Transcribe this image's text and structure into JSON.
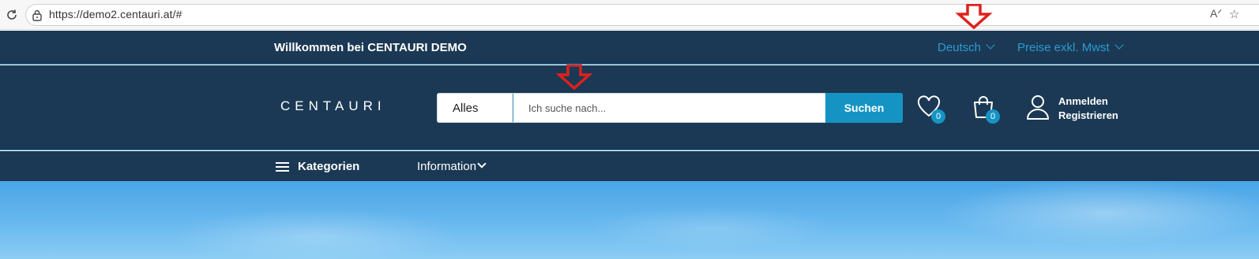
{
  "browser": {
    "url": "https://demo2.centauri.at/#"
  },
  "topbar": {
    "welcome": "Willkommen bei CENTAURI DEMO",
    "language": "Deutsch",
    "price_mode": "Preise exkl. Mwst"
  },
  "header": {
    "logo": "CENTAURI",
    "search": {
      "category": "Alles",
      "placeholder": "Ich suche nach...",
      "button": "Suchen"
    },
    "wishlist_count": "0",
    "cart_count": "0",
    "login": "Anmelden",
    "register": "Registrieren"
  },
  "nav": {
    "categories": "Kategorien",
    "information": "Information"
  },
  "colors": {
    "header_bg": "#1b3954",
    "accent": "#1594c4",
    "link": "#2b9bd1",
    "annotation": "#e0201c"
  }
}
